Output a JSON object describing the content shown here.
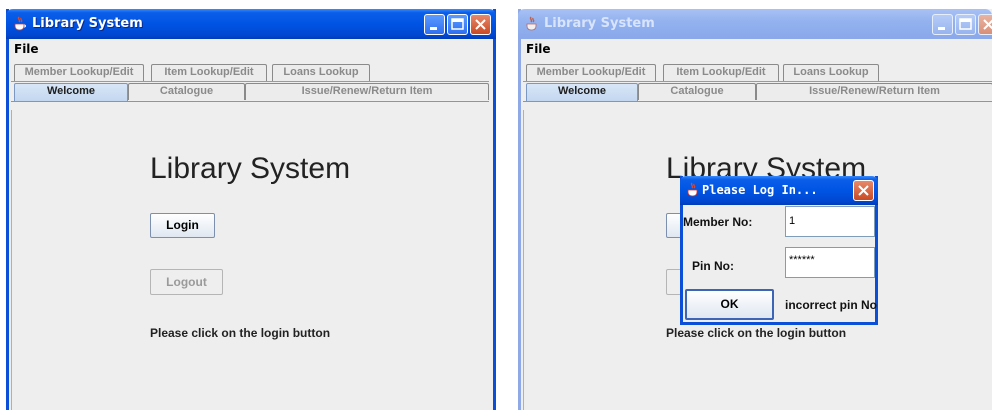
{
  "windows": [
    {
      "title": "Library System",
      "state": "active",
      "menu": {
        "file": "File"
      },
      "tabs_row1": [
        "Member Lookup/Edit",
        "Item Lookup/Edit",
        "Loans Lookup"
      ],
      "tabs_row2": [
        "Welcome",
        "Catalogue",
        "Issue/Renew/Return Item"
      ],
      "selected_tab": "Welcome",
      "welcome": {
        "heading": "Library System",
        "login_label": "Login",
        "logout_label": "Logout",
        "logout_enabled": false,
        "status_message": "Please click on the login button"
      }
    },
    {
      "title": "Library System",
      "state": "inactive",
      "menu": {
        "file": "File"
      },
      "tabs_row1": [
        "Member Lookup/Edit",
        "Item Lookup/Edit",
        "Loans Lookup"
      ],
      "tabs_row2": [
        "Welcome",
        "Catalogue",
        "Issue/Renew/Return Item"
      ],
      "selected_tab": "Welcome",
      "welcome": {
        "heading": "Library System",
        "status_message": "Please click on the login button"
      }
    }
  ],
  "dialog": {
    "title": "Please Log In...",
    "member_label": "Member No:",
    "member_value": "1",
    "pin_label": "Pin No:",
    "pin_value": "******",
    "ok_label": "OK",
    "error_message": "incorrect pin No"
  },
  "colors": {
    "titlebar_active": "#0054e3",
    "titlebar_inactive": "#93b2ef",
    "close_button": "#c94a24",
    "window_background": "#eeeeee"
  },
  "icons": [
    "java-cup-icon",
    "minimize-icon",
    "maximize-icon",
    "close-icon"
  ]
}
